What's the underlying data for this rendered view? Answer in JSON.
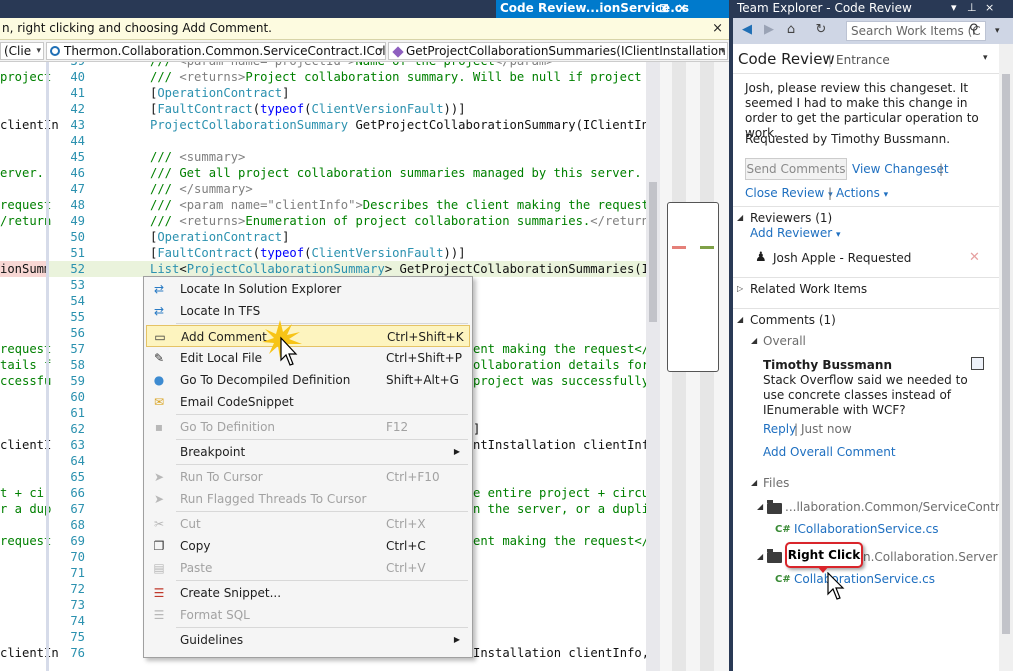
{
  "editor": {
    "doc_tab": {
      "label": "Code Review...ionService.cs",
      "pin": "⊠",
      "close": "×"
    },
    "tip": {
      "text": "n, right clicking and choosing Add Comment.",
      "close": "×"
    },
    "navbar": {
      "left": "(Clie",
      "middle": "Thermon.Collaboration.Common.ServiceContract.ICollab",
      "right": "GetProjectCollaborationSummaries(IClientInstallation clie"
    },
    "left_fragments": [
      {
        "row": 1,
        "text": "project"
      },
      {
        "row": 4,
        "text": "clientIn"
      },
      {
        "row": 7,
        "text": "erver."
      },
      {
        "row": 9,
        "text": "request"
      },
      {
        "row": 10,
        "text": "/return"
      },
      {
        "row": 13,
        "text": "ionSumm"
      },
      {
        "row": 18,
        "text": "request"
      },
      {
        "row": 19,
        "text": "tails f"
      },
      {
        "row": 20,
        "text": "ccessfu"
      },
      {
        "row": 24,
        "text": "clientI"
      },
      {
        "row": 27,
        "text": "t + ci"
      },
      {
        "row": 28,
        "text": "r a dup"
      },
      {
        "row": 30,
        "text": "request"
      },
      {
        "row": 37,
        "text": "clientIn"
      }
    ],
    "lines": [
      {
        "n": "39",
        "t": "/// <param name=\"projectId\">Name of the project</param>"
      },
      {
        "n": "40",
        "t": "/// <returns>Project collaboration summary. Will be null if project doe"
      },
      {
        "n": "41",
        "t": "[OperationContract]"
      },
      {
        "n": "42",
        "t": "[FaultContract(typeof(ClientVersionFault))]"
      },
      {
        "n": "43",
        "t": "ProjectCollaborationSummary GetProjectCollaborationSummary(IClientInsta"
      },
      {
        "n": "44",
        "t": ""
      },
      {
        "n": "45",
        "t": "/// <summary>"
      },
      {
        "n": "46",
        "t": "/// Get all project collaboration summaries managed by this server."
      },
      {
        "n": "47",
        "t": "/// </summary>"
      },
      {
        "n": "48",
        "t": "/// <param name=\"clientInfo\">Describes the client making the request</p"
      },
      {
        "n": "49",
        "t": "/// <returns>Enumeration of project collaboration summaries.</returns>"
      },
      {
        "n": "50",
        "t": "[OperationContract]"
      },
      {
        "n": "51",
        "t": "[FaultContract(typeof(ClientVersionFault))]"
      },
      {
        "n": "52",
        "t": "List<ProjectCollaborationSummary> GetProjectCollaborationSummaries(ICli"
      },
      {
        "n": "53",
        "t": ""
      },
      {
        "n": "54",
        "t": ""
      },
      {
        "n": "55",
        "t": ""
      },
      {
        "n": "56",
        "t": ""
      },
      {
        "n": "57",
        "t": "ent making the request</p"
      },
      {
        "n": "58",
        "t": "ollaboration details for"
      },
      {
        "n": "59",
        "t": "project was successfully"
      },
      {
        "n": "60",
        "t": ""
      },
      {
        "n": "61",
        "t": ""
      },
      {
        "n": "62",
        "t": "]"
      },
      {
        "n": "63",
        "t": "ntInstallation clientInfo"
      },
      {
        "n": "64",
        "t": ""
      },
      {
        "n": "65",
        "t": ""
      },
      {
        "n": "66",
        "t": "e entire project + circu"
      },
      {
        "n": "67",
        "t": "n the server, or a dupli"
      },
      {
        "n": "68",
        "t": ""
      },
      {
        "n": "69",
        "t": "ent making the request</p"
      },
      {
        "n": "70",
        "t": ""
      },
      {
        "n": "71",
        "t": ""
      },
      {
        "n": "72",
        "t": ""
      },
      {
        "n": "73",
        "t": ""
      },
      {
        "n": "74",
        "t": ""
      },
      {
        "n": "75",
        "t": ""
      },
      {
        "n": "76",
        "t": "Installation clientInfo,"
      }
    ]
  },
  "context_menu": {
    "items": [
      {
        "label": "Locate In Solution Explorer",
        "shortcut": "",
        "icon": "sync-arrows-icon",
        "glyph": "⇄",
        "disabled": false
      },
      {
        "label": "Locate In TFS",
        "shortcut": "",
        "icon": "sync-arrows-icon",
        "glyph": "⇄",
        "disabled": false
      },
      {
        "label": "Add Comment",
        "shortcut": "Ctrl+Shift+K",
        "icon": "comment-icon",
        "glyph": "▭",
        "disabled": false,
        "highlighted": true
      },
      {
        "label": "Edit Local File",
        "shortcut": "Ctrl+Shift+P",
        "icon": "edit-icon",
        "glyph": "✎",
        "disabled": false
      },
      {
        "label": "Go To Decompiled Definition",
        "shortcut": "Shift+Alt+G",
        "icon": "decompile-icon",
        "glyph": "●",
        "disabled": false
      },
      {
        "label": "Email CodeSnippet",
        "shortcut": "",
        "icon": "email-icon",
        "glyph": "✉",
        "disabled": false
      },
      {
        "label": "Go To Definition",
        "shortcut": "F12",
        "icon": "goto-definition-icon",
        "glyph": "▪",
        "disabled": true
      },
      {
        "label": "Breakpoint",
        "shortcut": "",
        "icon": "",
        "glyph": "",
        "disabled": false,
        "submenu": true
      },
      {
        "label": "Run To Cursor",
        "shortcut": "Ctrl+F10",
        "icon": "run-to-cursor-icon",
        "glyph": "➤",
        "disabled": true
      },
      {
        "label": "Run Flagged Threads To Cursor",
        "shortcut": "",
        "icon": "run-flagged-icon",
        "glyph": "➤",
        "disabled": true
      },
      {
        "label": "Cut",
        "shortcut": "Ctrl+X",
        "icon": "cut-icon",
        "glyph": "✂",
        "disabled": true
      },
      {
        "label": "Copy",
        "shortcut": "Ctrl+C",
        "icon": "copy-icon",
        "glyph": "❐",
        "disabled": false
      },
      {
        "label": "Paste",
        "shortcut": "Ctrl+V",
        "icon": "paste-icon",
        "glyph": "▤",
        "disabled": true
      },
      {
        "label": "Create Snippet...",
        "shortcut": "",
        "icon": "snippet-icon",
        "glyph": "☰",
        "disabled": false
      },
      {
        "label": "Format SQL",
        "shortcut": "",
        "icon": "format-sql-icon",
        "glyph": "☰",
        "disabled": true
      },
      {
        "label": "Guidelines",
        "shortcut": "",
        "icon": "",
        "glyph": "",
        "disabled": false,
        "submenu": true
      }
    ]
  },
  "team_explorer": {
    "title": "Team Explorer - Code Review",
    "title_controls": [
      "▾",
      "⊥",
      "×"
    ],
    "search_placeholder": "Search Work Items (C",
    "header": {
      "title": "Code Review",
      "separator": "|",
      "subtitle": "Entrance"
    },
    "description": "Josh, please review this changeset.  It seemed I had to make this change in order to get the particular operation to work.",
    "requested_by": "Requested by Timothy Bussmann.",
    "send_comments": "Send Comments",
    "view_changeset": "View Changeset",
    "link_separator": "|",
    "close_review": "Close Review",
    "actions": "Actions",
    "reviewers": {
      "header": "Reviewers (1)",
      "add": "Add Reviewer",
      "item": "Josh Apple - Requested",
      "remove": "✕"
    },
    "related_work_items": "Related Work Items",
    "comments": {
      "header": "Comments (1)",
      "overall": "Overall",
      "author": "Timothy Bussmann",
      "text": "Stack Overflow said we needed to use concrete classes instead of IEnumerable with WCF?",
      "reply": "Reply",
      "time": "Just now",
      "add_overall": "Add Overall Comment"
    },
    "files": {
      "header": "Files",
      "folder1": "...llaboration.Common/ServiceContract",
      "file1": "ICollaborationService.cs",
      "folder2": "n.Collaboration.Server",
      "file2": "CollaborationService.cs",
      "cs_label": "C#"
    },
    "callout": "Right Click"
  },
  "colors": {
    "accent": "#007acc",
    "title_bar": "#293955",
    "link": "#1e6fc0",
    "comment_green": "#008000",
    "keyword_blue": "#0000ff",
    "type_teal": "#2b91af",
    "menu_highlight": "#fdf4bf",
    "callout_red": "#d9252b"
  }
}
